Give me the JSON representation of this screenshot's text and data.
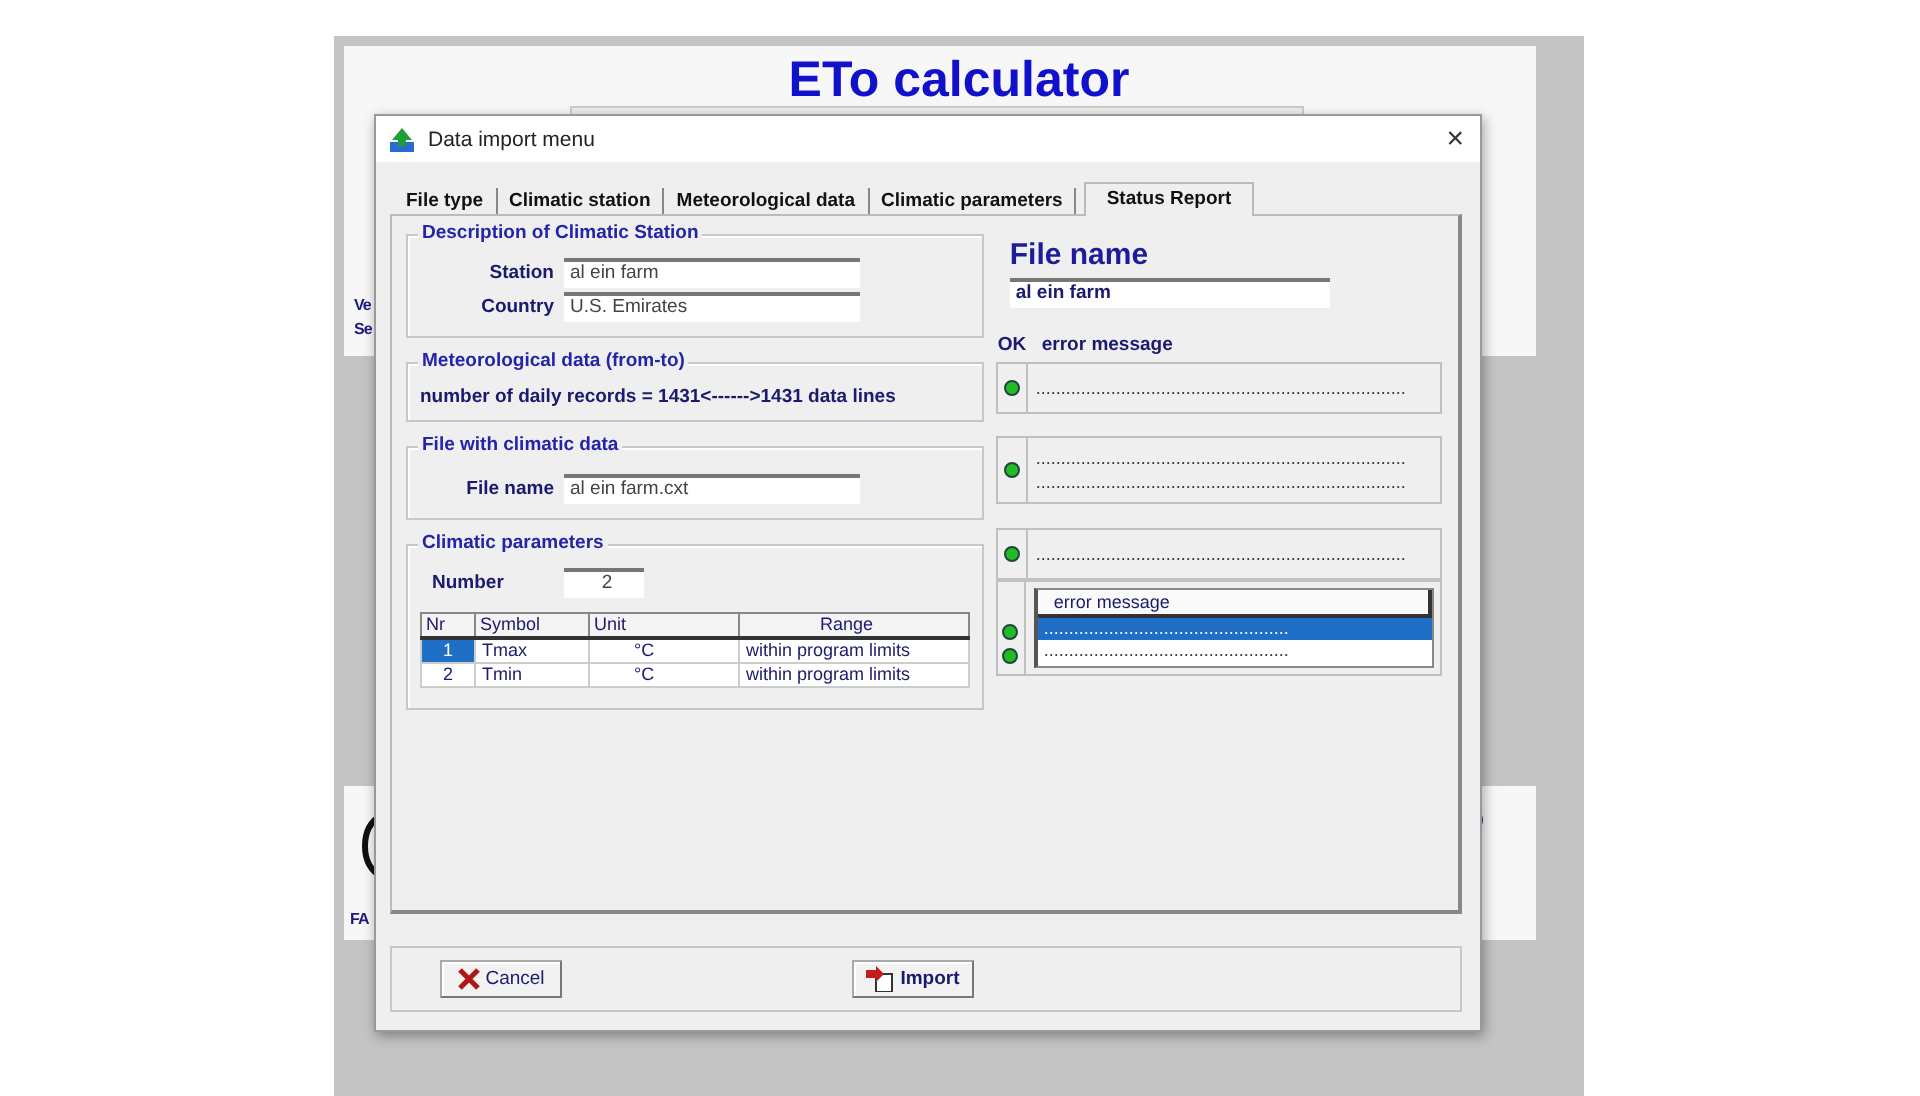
{
  "background_window": {
    "title": "ETo calculator",
    "fragments": [
      "Ve",
      "Se",
      "FA"
    ]
  },
  "dialog": {
    "title": "Data import menu",
    "close": "×"
  },
  "tabs": [
    {
      "label": "File type",
      "selected": false
    },
    {
      "label": "Climatic station",
      "selected": false
    },
    {
      "label": "Meteorological data",
      "selected": false
    },
    {
      "label": "Climatic parameters",
      "selected": false
    },
    {
      "label": "Status Report",
      "selected": true
    }
  ],
  "station_group": {
    "title": "Description of Climatic Station",
    "fields": [
      {
        "label": "Station",
        "value": "al ein farm"
      },
      {
        "label": "Country",
        "value": "U.S. Emirates"
      }
    ]
  },
  "meteo_group": {
    "title": "Meteorological data (from-to)",
    "text": "number of daily records = 1431<------>1431 data lines"
  },
  "file_group": {
    "title": "File with climatic data",
    "label": "File name",
    "value": "al ein farm.cxt"
  },
  "params_group": {
    "title": "Climatic parameters",
    "number_label": "Number",
    "number_value": "2",
    "table": {
      "columns": [
        "Nr",
        "Symbol",
        "Unit",
        "Range"
      ],
      "rows": [
        {
          "cells": [
            "1",
            "Tmax",
            "°C",
            "within program limits"
          ],
          "selected": true
        },
        {
          "cells": [
            "2",
            "Tmin",
            "°C",
            "within program limits"
          ],
          "selected": false
        }
      ]
    }
  },
  "file_name": {
    "heading": "File name",
    "value": "al ein farm"
  },
  "status": {
    "ok_header": "OK",
    "message_header": "error message",
    "rows": [
      {
        "kind": "lines",
        "ok": true,
        "lines": [
          ".........................................................................."
        ]
      },
      {
        "kind": "lines",
        "ok": true,
        "lines": [
          "..........................................................................",
          ".........................................................................."
        ]
      },
      {
        "kind": "lines",
        "ok": true,
        "lines": [
          ".........................................................................."
        ]
      },
      {
        "kind": "list",
        "header": "error message",
        "items": [
          {
            "ok": true,
            "text": ".................................................",
            "selected": true
          },
          {
            "ok": true,
            "text": ".................................................",
            "selected": false
          }
        ]
      }
    ]
  },
  "buttons": [
    {
      "kind": "cancel",
      "label": "Cancel"
    },
    {
      "kind": "import",
      "label": "Import"
    }
  ]
}
